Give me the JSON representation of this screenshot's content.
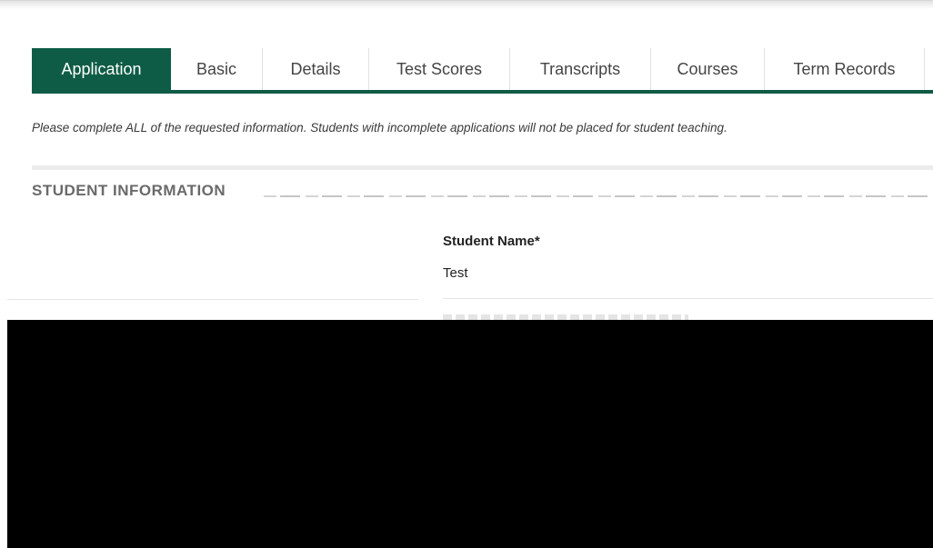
{
  "tabs": [
    {
      "label": "Application",
      "active": true
    },
    {
      "label": "Basic",
      "active": false
    },
    {
      "label": "Details",
      "active": false
    },
    {
      "label": "Test Scores",
      "active": false
    },
    {
      "label": "Transcripts",
      "active": false
    },
    {
      "label": "Courses",
      "active": false
    },
    {
      "label": "Term Records",
      "active": false
    }
  ],
  "notice": "Please complete ALL of the requested information. Students with incomplete applications will not be placed for student teaching.",
  "section": {
    "title": "STUDENT INFORMATION"
  },
  "fields": {
    "student_name": {
      "label": "Student Name*",
      "value": "Test"
    }
  },
  "colors": {
    "accent": "#0e5c45",
    "redaction": "#000000"
  }
}
